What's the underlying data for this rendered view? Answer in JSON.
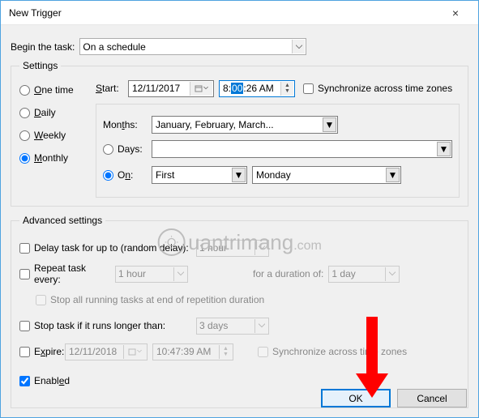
{
  "window": {
    "title": "New Trigger",
    "close": "×"
  },
  "begin": {
    "label": "Begin the task:",
    "value": "On a schedule"
  },
  "settings": {
    "legend": "Settings",
    "freq": {
      "onetime": "One time",
      "daily": "Daily",
      "weekly": "Weekly",
      "monthly": "Monthly",
      "selected": "monthly"
    },
    "start_label": "Start:",
    "start_date": "12/11/2017",
    "start_time_pre": "8:",
    "start_time_sel": "00",
    "start_time_post": ":26 AM",
    "sync_tz": "Synchronize across time zones",
    "months_label": "Months:",
    "months_value": "January, February, March...",
    "days_label": "Days:",
    "days_value": "",
    "on_label": "On:",
    "on_ordinal": "First",
    "on_day": "Monday"
  },
  "adv": {
    "legend": "Advanced settings",
    "delay_label": "Delay task for up to (random delay):",
    "delay_value": "1 hour",
    "repeat_label": "Repeat task every:",
    "repeat_value": "1 hour",
    "duration_label": "for a duration of:",
    "duration_value": "1 day",
    "stop_repeat": "Stop all running tasks at end of repetition duration",
    "stop_long_label": "Stop task if it runs longer than:",
    "stop_long_value": "3 days",
    "expire_label": "Expire:",
    "expire_date": "12/11/2018",
    "expire_time": "10:47:39 AM",
    "expire_sync": "Synchronize across time zones",
    "enabled": "Enabled"
  },
  "buttons": {
    "ok": "OK",
    "cancel": "Cancel"
  },
  "watermark": {
    "text": "uantrimang",
    "suffix": ".com"
  }
}
